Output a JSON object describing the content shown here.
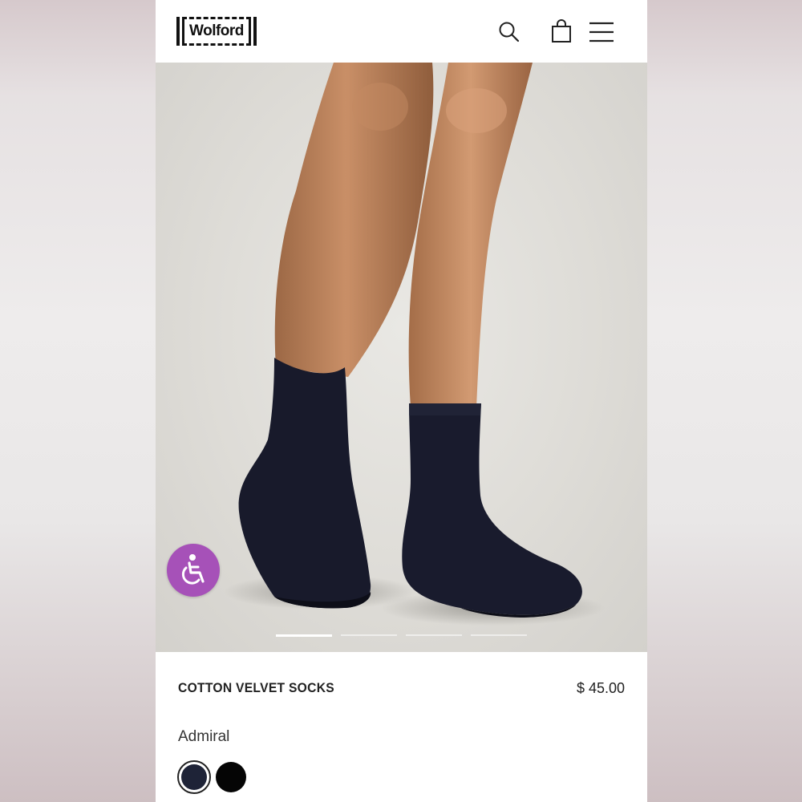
{
  "header": {
    "logo_text": "Wolford",
    "icons": {
      "search": "search-icon",
      "bag": "shopping-bag-icon",
      "menu": "hamburger-menu-icon"
    }
  },
  "hero": {
    "carousel_slides": 4,
    "active_slide": 1,
    "accessibility_icon": "wheelchair-icon",
    "accessibility_color": "#a651b8"
  },
  "product": {
    "name": "COTTON VELVET SOCKS",
    "price": "$ 45.00",
    "selected_color": "Admiral",
    "swatches": [
      {
        "color": "#1e2337",
        "selected": true
      },
      {
        "color": "#050505",
        "selected": false
      }
    ]
  }
}
